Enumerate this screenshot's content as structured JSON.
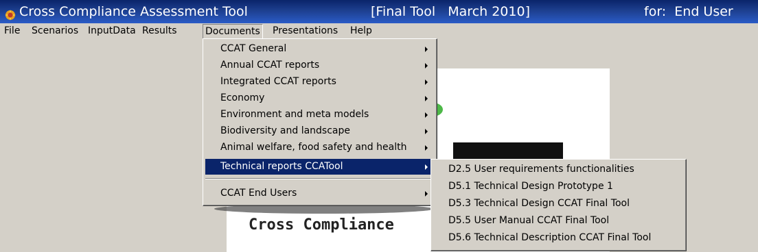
{
  "titlebar": {
    "title": "Cross Compliance Assessment Tool",
    "version": "[Final Tool   March 2010]",
    "user": "for:  End User",
    "icon": "app-icon"
  },
  "menubar": {
    "items": [
      "File",
      "Scenarios",
      "InputData",
      "Results",
      "Documents",
      "Presentations",
      "Help"
    ],
    "active": "Documents"
  },
  "documents_menu": {
    "items": [
      "CCAT General",
      "Annual CCAT reports",
      "Integrated CCAT reports",
      "Economy",
      "Environment and meta models",
      "Biodiversity and landscape",
      "Animal welfare, food safety and health",
      "Technical reports CCATool",
      "CCAT End Users"
    ],
    "selected": "Technical reports CCATool"
  },
  "submenu": {
    "items": [
      "D2.5 User requirements functionalities",
      "D5.1 Technical Design Prototype 1",
      "D5.3 Technical Design CCAT Final Tool",
      "D5.5 User Manual CCAT Final Tool",
      "D5.6 Technical Description CCAT Final Tool"
    ]
  },
  "splash": {
    "text": "Cross Compliance"
  },
  "colors": {
    "selection": "#0a246a",
    "face": "#d4d0c8",
    "logo_green": "#4db848"
  }
}
